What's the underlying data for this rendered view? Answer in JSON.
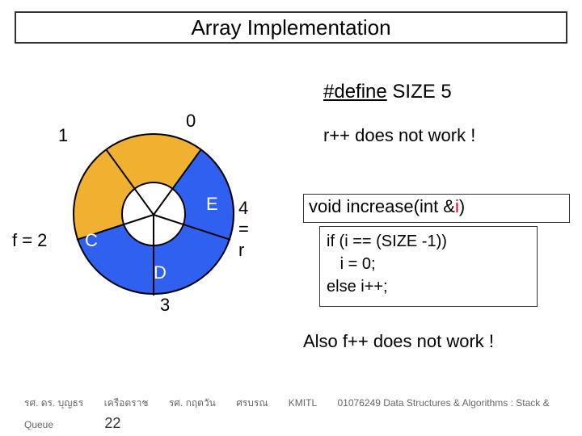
{
  "title": "Array Implementation",
  "define_kw": "#define",
  "define_rest": " SIZE  5",
  "rplus_text": "r++ does not work !",
  "func_sig_prefix": "void increase(int &",
  "func_param_name": "i",
  "func_sig_suffix": ")",
  "func_body": "if (i == (SIZE -1))\n   i = 0;\nelse i++;",
  "also_text": "Also f++ does not work !",
  "chart_data": {
    "type": "ring",
    "size_constant": 5,
    "front_index": 2,
    "rear_index": 4,
    "slots": [
      {
        "index": 0,
        "value": null
      },
      {
        "index": 1,
        "value": null
      },
      {
        "index": 2,
        "value": "C"
      },
      {
        "index": 3,
        "value": "D"
      },
      {
        "index": 4,
        "value": "E"
      }
    ],
    "index_labels": {
      "0": "0",
      "1": "1",
      "3": "3",
      "front": "f = 2",
      "rear": "4 = r"
    },
    "colors": {
      "empty": "#f0b030",
      "filled": "#3060f0"
    }
  },
  "footer": {
    "names": [
      "รศ. ดร. บุญธร",
      "เครือตราช",
      "รศ. กฤตวัน",
      "ศรบรณ",
      "KMITL",
      "01076249 Data Structures & Algorithms : Stack &"
    ],
    "line2_left": "Queue",
    "page_number": "22"
  }
}
